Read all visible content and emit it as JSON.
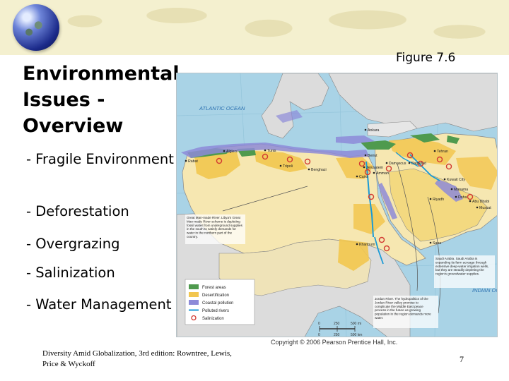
{
  "slide": {
    "title_lines": [
      "Environmental",
      "Issues -",
      "Overview"
    ],
    "bullets": [
      "- Fragile Environment",
      "- Deforestation",
      "- Overgrazing",
      "- Salinization",
      "- Water Management"
    ],
    "figure_label": "Figure 7.6",
    "footer_citation": "Diversity Amid Globalization, 3rd edition:  Rowntree, Lewis, Price & Wyckoff",
    "page_number": "7"
  },
  "map": {
    "ocean_labels": {
      "atlantic": "ATLANTIC OCEAN",
      "indian": "INDIAN OCEAN"
    },
    "city_labels": [
      "Algiers",
      "Tunis",
      "Rabat",
      "Tripoli",
      "Benghazi",
      "Cairo",
      "Beirut",
      "Damascus",
      "Jerusalem",
      "Amman",
      "Baghdad",
      "Tehran",
      "Kuwait City",
      "Manama",
      "Riyadh",
      "Doha",
      "Abu Dhabi",
      "Muscat",
      "Sana",
      "Khartoum",
      "Ankara"
    ],
    "legend": {
      "title": "",
      "items": [
        {
          "label": "Forest areas",
          "color": "#4f9a4e",
          "kind": "fill"
        },
        {
          "label": "Desertification",
          "color": "#f2c64f",
          "kind": "fill"
        },
        {
          "label": "Coastal pollution",
          "color": "#8d8ad8",
          "kind": "fill"
        },
        {
          "label": "Polluted rivers",
          "color": "#1a9ad6",
          "kind": "line"
        },
        {
          "label": "Salinization",
          "color": "#d23a32",
          "kind": "circle"
        }
      ],
      "scale_labels": [
        "0",
        "250",
        "500 mi",
        "0",
        "250",
        "500 km"
      ]
    },
    "callouts": [
      "Great Man-made River. Libya's Great Man-made River scheme is depleting fossil water from underground supplies in the south to satisfy demands for water in the northern part of the country.",
      "Saudi Arabia. Saudi Arabia is expanding its farm acreage through extensive deep-water irrigation wells, but they are steadily depleting the region's groundwater supplies.",
      "Jordan River. The hydropolitics of the Jordan River valley promise to complicate the Middle East peace process in the future as growing population in the region demands more water."
    ],
    "copyright": "Copyright © 2006 Pearson Prentice Hall, Inc."
  }
}
